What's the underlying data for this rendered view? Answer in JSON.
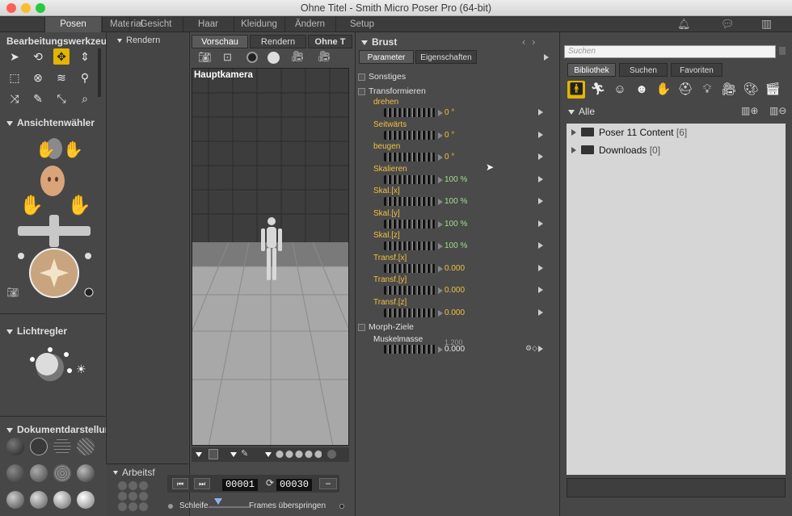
{
  "window": {
    "title": "Ohne Titel - Smith Micro Poser Pro  (64-bit)"
  },
  "main_tabs": [
    "Posen",
    "Material",
    "Gesicht",
    "Haar",
    "Kleidung",
    "Ändern",
    "Setup"
  ],
  "left": {
    "editing_tools_title": "Bearbeitungswerkzeug",
    "camera_selector_title": "Ansichtenwähler",
    "light_title": "Lichtregler",
    "doc_display_title": "Dokumentdarstellur"
  },
  "render_panel": {
    "title": "Rendern",
    "workspace_title": "Arbeitsf"
  },
  "viewport": {
    "tabs": [
      "Vorschau",
      "Rendern",
      "Ohne T"
    ],
    "camera_label": "Hauptkamera"
  },
  "timeline": {
    "start_frame": "00001",
    "end_frame": "00030",
    "loop_label": "Schleife",
    "skip_frames_label": "Frames überspringen"
  },
  "params": {
    "title": "Brust",
    "tabs": [
      "Parameter",
      "Eigenschaften"
    ],
    "sections": {
      "misc": "Sonstiges",
      "transform": "Transformieren",
      "morph": "Morph-Ziele"
    },
    "rows": [
      {
        "label": "drehen",
        "value": "0 °",
        "kind": "deg"
      },
      {
        "label": "Seitwärts",
        "value": "0 °",
        "kind": "deg"
      },
      {
        "label": "beugen",
        "value": "0 °",
        "kind": "deg"
      },
      {
        "label": "Skalieren",
        "value": "100 %",
        "kind": "pct"
      },
      {
        "label": "Skal.[x]",
        "value": "100 %",
        "kind": "pct"
      },
      {
        "label": "Skal.[y]",
        "value": "100 %",
        "kind": "pct"
      },
      {
        "label": "Skal.[z]",
        "value": "100 %",
        "kind": "pct"
      },
      {
        "label": "Transf.[x]",
        "value": "0.000",
        "kind": "num"
      },
      {
        "label": "Transf.[y]",
        "value": "0.000",
        "kind": "num"
      },
      {
        "label": "Transf.[z]",
        "value": "0.000",
        "kind": "num"
      }
    ],
    "morph": {
      "label": "Muskelmasse",
      "max": "1.200",
      "value": "0.000"
    }
  },
  "library": {
    "search_placeholder": "Suchen",
    "tabs": [
      "Bibliothek",
      "Suchen",
      "Favoriten"
    ],
    "all_label": "Alle",
    "items": [
      {
        "name": "Poser 11 Content",
        "count": "[6]"
      },
      {
        "name": "Downloads",
        "count": "[0]"
      }
    ]
  },
  "colors": {
    "accent": "#e4b400",
    "param_label": "#f0c040",
    "param_pct": "#9ee08a"
  }
}
